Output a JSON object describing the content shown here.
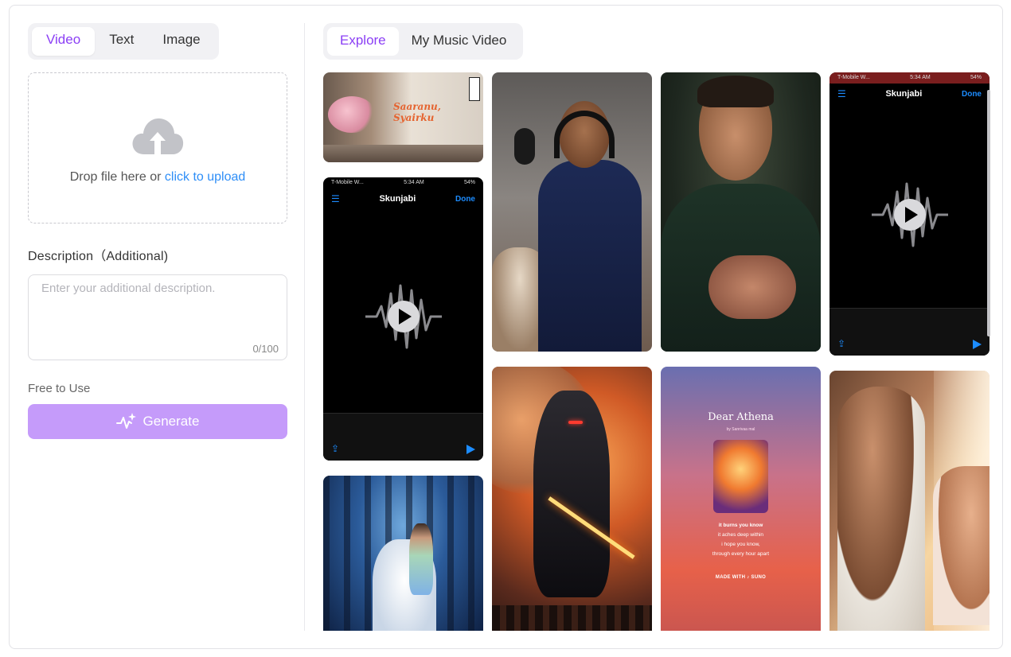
{
  "left": {
    "tabs": [
      {
        "label": "Video",
        "active": true
      },
      {
        "label": "Text",
        "active": false
      },
      {
        "label": "Image",
        "active": false
      }
    ],
    "upload": {
      "text": "Drop file here or ",
      "link": "click to upload",
      "icon": "cloud-upload-icon"
    },
    "description": {
      "label": "Description（Additional)",
      "placeholder": "Enter your additional description.",
      "counter": "0/100"
    },
    "free_label": "Free to Use",
    "generate_label": "Generate",
    "accent_color": "#8b3ff5",
    "button_color": "#c59bfa"
  },
  "right": {
    "tabs": [
      {
        "label": "Explore",
        "active": true
      },
      {
        "label": "My Music Video",
        "active": false
      }
    ],
    "cards": {
      "wedding": {
        "title": "Saaranu, Syairku"
      },
      "phone1": {
        "carrier": "T-Mobile W...",
        "time": "5:34 AM",
        "battery": "54%",
        "title": "Skunjabi",
        "done": "Done"
      },
      "phone2": {
        "carrier": "T-Mobile W...",
        "time": "5:34 AM",
        "battery": "54%",
        "title": "Skunjabi",
        "done": "Done"
      },
      "athena": {
        "title": "Dear Athena",
        "byline": "by Sanrivaa mal",
        "lyrics_bold": "it burns you know",
        "lyrics": [
          "it aches deep within",
          "i hope you know,",
          "through every hour apart"
        ],
        "made_with": "MADE WITH ♪ SUNO"
      }
    }
  }
}
